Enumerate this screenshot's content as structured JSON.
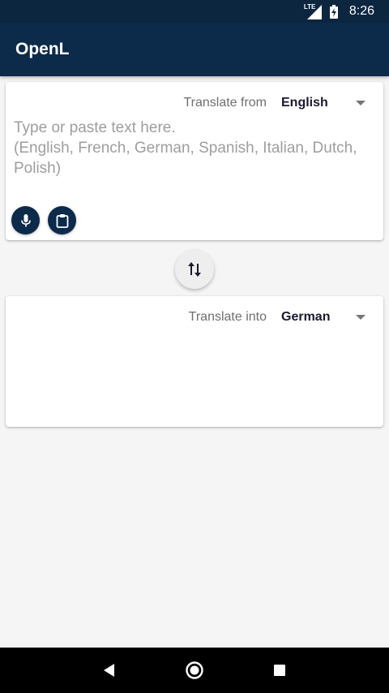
{
  "status_bar": {
    "network": "LTE",
    "time": "8:26"
  },
  "app_bar": {
    "title": "OpenL"
  },
  "source_card": {
    "caption": "Translate from",
    "language": "English",
    "input_value": "",
    "placeholder": "Type or paste text here.\n(English, French, German, Spanish, Italian, Dutch, Polish)",
    "icons": [
      "microphone-icon",
      "clipboard-icon"
    ]
  },
  "target_card": {
    "caption": "Translate into",
    "language": "German",
    "output_value": ""
  },
  "swap": {
    "icon": "swap-vertical-icon"
  },
  "navigation": {
    "icons": [
      "back-icon",
      "home-icon",
      "recents-icon"
    ]
  },
  "colors": {
    "status_bar": "#0c2640",
    "app_bar": "#0c2a4a",
    "accent": "#0c2a4a",
    "background": "#f5f5f5",
    "card": "#ffffff"
  }
}
